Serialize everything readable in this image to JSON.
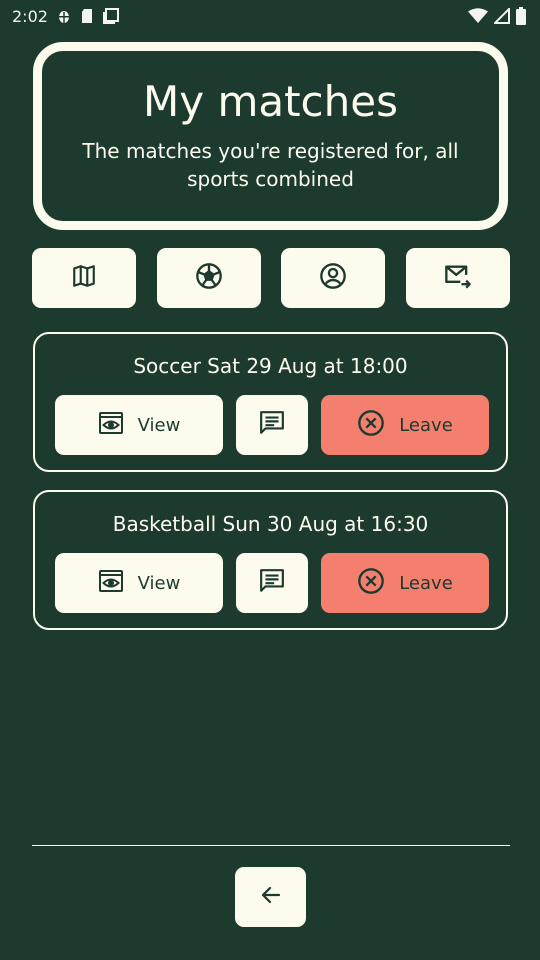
{
  "status_bar": {
    "time": "2:02",
    "icons": [
      "bug-icon",
      "sim-card-icon",
      "screenshot-icon",
      "wifi-icon",
      "signal-icon",
      "battery-icon"
    ]
  },
  "header": {
    "title": "My matches",
    "subtitle": "The matches you're registered for, all sports combined"
  },
  "nav": {
    "items": [
      {
        "icon": "map-icon"
      },
      {
        "icon": "soccer-ball-icon"
      },
      {
        "icon": "account-icon"
      },
      {
        "icon": "mail-forward-icon"
      }
    ]
  },
  "matches": [
    {
      "title": "Soccer Sat 29 Aug at 18:00",
      "view_label": "View",
      "leave_label": "Leave"
    },
    {
      "title": "Basketball Sun 30 Aug at 16:30",
      "view_label": "View",
      "leave_label": "Leave"
    }
  ],
  "footer": {
    "back_icon": "arrow-left-icon"
  },
  "colors": {
    "background": "#1c3a2e",
    "surface": "#fdfbee",
    "leave": "#f47f6e",
    "text_dark": "#1c3a2e"
  }
}
